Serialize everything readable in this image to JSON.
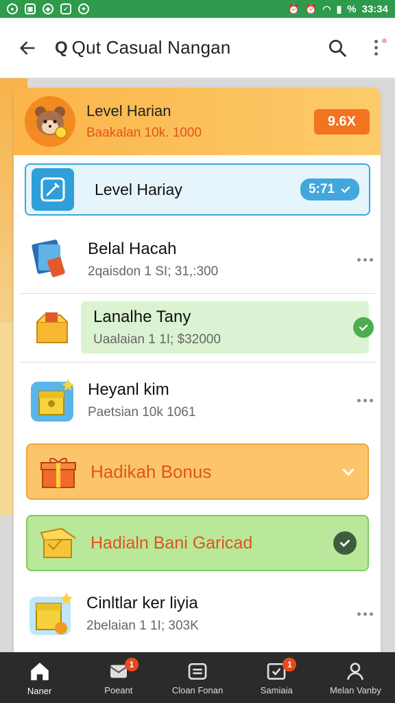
{
  "status_bar": {
    "left_icons": [
      "settings-icon",
      "image-icon",
      "shield-icon",
      "mail-icon",
      "app-icon"
    ],
    "right_icons": [
      "alarm-icon",
      "alarm-icon",
      "wifi-icon",
      "signal-icon"
    ],
    "battery": "%",
    "time": "33:34"
  },
  "app_bar": {
    "title_prefix": "Q",
    "title": "Qut Casual Nangan"
  },
  "hero": {
    "title": "Level Harian",
    "subtitle": "Baakalan 10k. 1000",
    "badge": "9.6X"
  },
  "selected_row": {
    "title": "Level Hariay",
    "badge": "5:71"
  },
  "rows": [
    {
      "title": "Belal Hacah",
      "subtitle": "2qaisdon 1 SI; 31,:300"
    },
    {
      "title": "Lanalhe Tany",
      "subtitle": "Uaalaian 1 1I; $32000"
    },
    {
      "title": "Heyanl kim",
      "subtitle": "Paetsian 10k 1061"
    },
    {
      "title": "Cinltlar ker liyia",
      "subtitle": "2belaian 1 1I; 303K"
    }
  ],
  "buttons": {
    "bonus": "Hadikah Bonus",
    "garicad": "Hadialn Bani Garicad"
  },
  "bottom_nav": [
    {
      "label": "Naner",
      "icon": "home-icon",
      "active": true
    },
    {
      "label": "Poeant",
      "icon": "mail-icon",
      "badge": "1"
    },
    {
      "label": "Cloan Fonan",
      "icon": "list-icon"
    },
    {
      "label": "Samiaia",
      "icon": "ticket-icon",
      "badge": "1"
    },
    {
      "label": "Melan Vanby",
      "icon": "person-icon"
    }
  ],
  "colors": {
    "status_bar": "#2e9a4c",
    "accent_orange": "#f2741f",
    "accent_blue": "#3aa6dc",
    "accent_green": "#4cae4f"
  }
}
